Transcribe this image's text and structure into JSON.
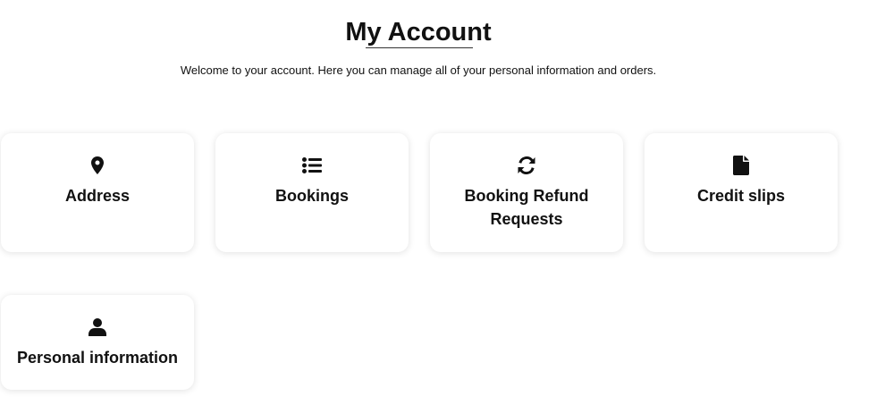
{
  "header": {
    "title": "My Account",
    "subtitle": "Welcome to your account. Here you can manage all of your personal information and orders."
  },
  "cards": [
    {
      "label": "Address",
      "icon": "map-pin-icon"
    },
    {
      "label": "Bookings",
      "icon": "list-icon"
    },
    {
      "label": "Booking Refund Requests",
      "icon": "refresh-icon"
    },
    {
      "label": "Credit slips",
      "icon": "file-icon"
    },
    {
      "label": "Personal information",
      "icon": "user-icon"
    }
  ]
}
